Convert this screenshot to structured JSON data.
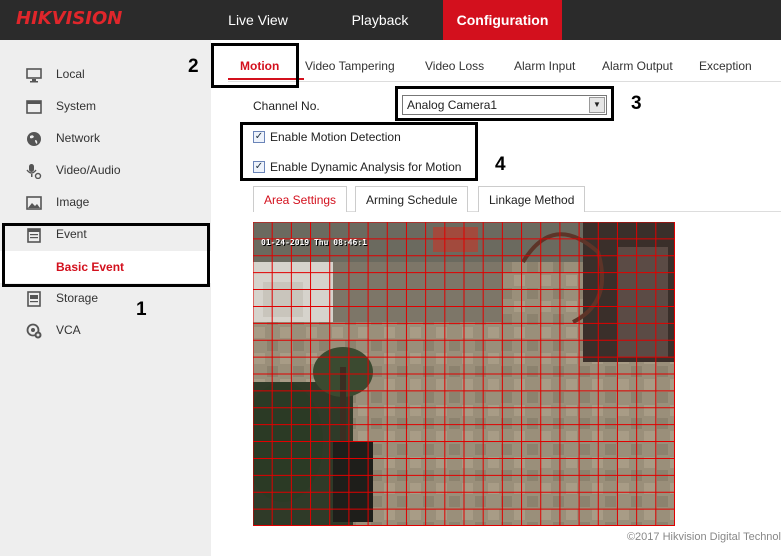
{
  "brand": {
    "logo_text": "HIKVISION",
    "accent": "#d3101d"
  },
  "topnav": [
    {
      "label": "Live View"
    },
    {
      "label": "Playback"
    },
    {
      "label": "Configuration",
      "active": true
    }
  ],
  "sidebar": {
    "items": [
      {
        "label": "Local",
        "icon": "monitor-icon"
      },
      {
        "label": "System",
        "icon": "system-icon"
      },
      {
        "label": "Network",
        "icon": "globe-icon"
      },
      {
        "label": "Video/Audio",
        "icon": "mic-icon"
      },
      {
        "label": "Image",
        "icon": "image-icon"
      },
      {
        "label": "Event",
        "icon": "calendar-icon"
      },
      {
        "label": "Storage",
        "icon": "storage-icon"
      },
      {
        "label": "VCA",
        "icon": "vca-icon"
      }
    ],
    "sub_item": {
      "label": "Basic Event",
      "active": true
    }
  },
  "tabs": [
    {
      "label": "Motion",
      "active": true
    },
    {
      "label": "Video Tampering"
    },
    {
      "label": "Video Loss"
    },
    {
      "label": "Alarm Input"
    },
    {
      "label": "Alarm Output"
    },
    {
      "label": "Exception"
    }
  ],
  "channel": {
    "label": "Channel No.",
    "value": "Analog Camera1"
  },
  "checkboxes": [
    {
      "label": "Enable Motion Detection",
      "checked": true
    },
    {
      "label": "Enable Dynamic Analysis for Motion",
      "checked": true
    }
  ],
  "subtabs": [
    {
      "label": "Area Settings",
      "active": true
    },
    {
      "label": "Arming Schedule"
    },
    {
      "label": "Linkage Method"
    }
  ],
  "video": {
    "osd": "01-24-2019 Thu 08:46:1"
  },
  "footer": {
    "copyright": "©2017 Hikvision Digital Technol"
  },
  "callouts": [
    "1",
    "2",
    "3",
    "4"
  ]
}
